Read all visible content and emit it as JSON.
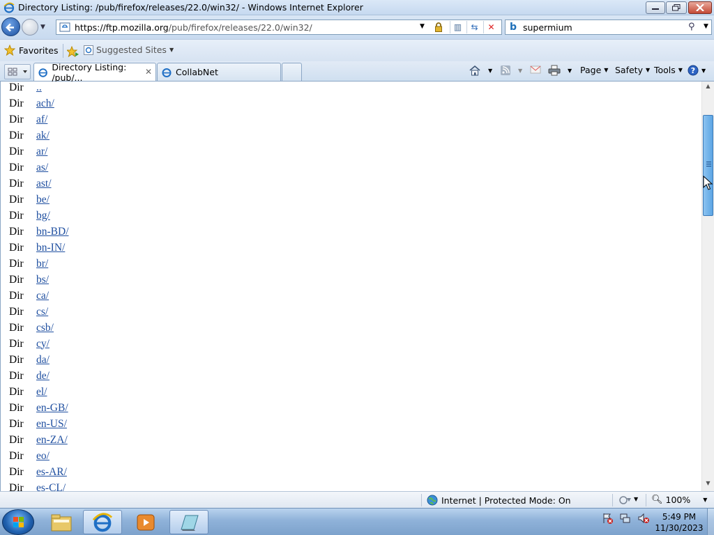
{
  "window": {
    "title": "Directory Listing: /pub/firefox/releases/22.0/win32/ - Windows Internet Explorer"
  },
  "address": {
    "url_prefix": "https://ftp.mozilla.org",
    "url_path": "/pub/firefox/releases/22.0/win32/"
  },
  "search": {
    "value": "supermium",
    "provider_icon": "bing-icon"
  },
  "favorites_bar": {
    "favorites_label": "Favorites",
    "suggested_label": "Suggested Sites"
  },
  "tabs": [
    {
      "label": "Directory Listing: /pub/...",
      "active": true
    },
    {
      "label": "CollabNet",
      "active": false
    }
  ],
  "command_bar": {
    "page_label": "Page",
    "safety_label": "Safety",
    "tools_label": "Tools"
  },
  "listing": [
    {
      "kind": "Dir",
      "name": ".."
    },
    {
      "kind": "Dir",
      "name": "ach/"
    },
    {
      "kind": "Dir",
      "name": "af/"
    },
    {
      "kind": "Dir",
      "name": "ak/"
    },
    {
      "kind": "Dir",
      "name": "ar/"
    },
    {
      "kind": "Dir",
      "name": "as/"
    },
    {
      "kind": "Dir",
      "name": "ast/"
    },
    {
      "kind": "Dir",
      "name": "be/"
    },
    {
      "kind": "Dir",
      "name": "bg/"
    },
    {
      "kind": "Dir",
      "name": "bn-BD/"
    },
    {
      "kind": "Dir",
      "name": "bn-IN/"
    },
    {
      "kind": "Dir",
      "name": "br/"
    },
    {
      "kind": "Dir",
      "name": "bs/"
    },
    {
      "kind": "Dir",
      "name": "ca/"
    },
    {
      "kind": "Dir",
      "name": "cs/"
    },
    {
      "kind": "Dir",
      "name": "csb/"
    },
    {
      "kind": "Dir",
      "name": "cy/"
    },
    {
      "kind": "Dir",
      "name": "da/"
    },
    {
      "kind": "Dir",
      "name": "de/"
    },
    {
      "kind": "Dir",
      "name": "el/"
    },
    {
      "kind": "Dir",
      "name": "en-GB/"
    },
    {
      "kind": "Dir",
      "name": "en-US/"
    },
    {
      "kind": "Dir",
      "name": "en-ZA/"
    },
    {
      "kind": "Dir",
      "name": "eo/"
    },
    {
      "kind": "Dir",
      "name": "es-AR/"
    },
    {
      "kind": "Dir",
      "name": "es-CL/"
    }
  ],
  "status_bar": {
    "zone_text": "Internet | Protected Mode: On",
    "zoom": "100%"
  },
  "taskbar": {
    "time": "5:49 PM",
    "date": "11/30/2023"
  },
  "colors": {
    "link": "#1f4fa0",
    "scroll_thumb": "#5ca5e4"
  }
}
